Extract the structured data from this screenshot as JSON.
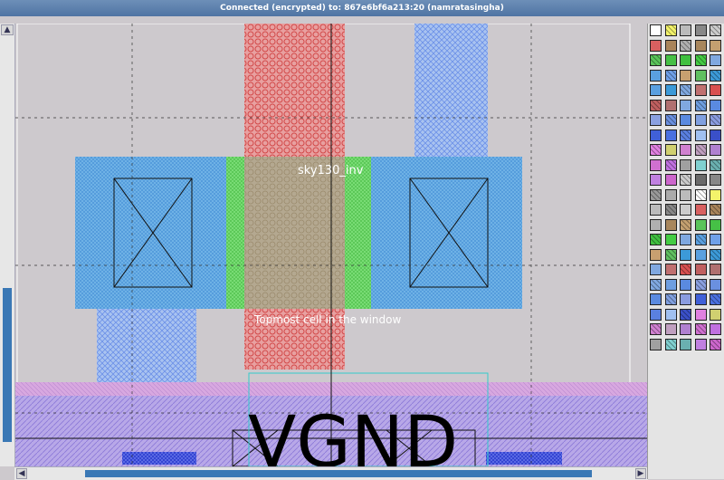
{
  "window": {
    "title": "Connected (encrypted) to: 867e6bf6a213:20 (namratasingha)"
  },
  "layout": {
    "cell_name": "sky130_inv",
    "topmost_label": "Topmost cell in the window",
    "pin_label": "VGND"
  },
  "scrollbars": {
    "up_arrow": "▲",
    "left_arrow": "◀",
    "right_arrow": "▶"
  },
  "palette": {
    "colors": [
      "#ffffff",
      "#f3f36a",
      "#bbbbbb",
      "#888888",
      "#cccccc",
      "#d86060",
      "#a9845a",
      "#b0b0b0",
      "#a8865c",
      "#c4a070",
      "#5ac45a",
      "#46c046",
      "#40c040",
      "#44cc44",
      "#7fa8e0",
      "#5aa0e0",
      "#6fa0e8",
      "#c8a070",
      "#60c060",
      "#3c9ad8",
      "#5aa0e0",
      "#3c9ad8",
      "#80a8e0",
      "#c07070",
      "#d85050",
      "#c06060",
      "#b07070",
      "#80a8e0",
      "#6e9ee0",
      "#5a8ae0",
      "#8aa0e0",
      "#6a90e0",
      "#5a8ae0",
      "#80a0e0",
      "#8a9ce0",
      "#4060d8",
      "#4a70e0",
      "#5a80e0",
      "#a0c0f0",
      "#3a50c8",
      "#e080e0",
      "#d0d070",
      "#d080d0",
      "#c0a0c0",
      "#b080d0",
      "#d070d0",
      "#c070e0",
      "#a0a0a0",
      "#80d0d0",
      "#6ab0b0",
      "#c080e0",
      "#cc66cc",
      "#cccccc",
      "#6a6a6a",
      "#888888",
      "#999999",
      "#aaaaaa",
      "#bbbbbb"
    ]
  }
}
